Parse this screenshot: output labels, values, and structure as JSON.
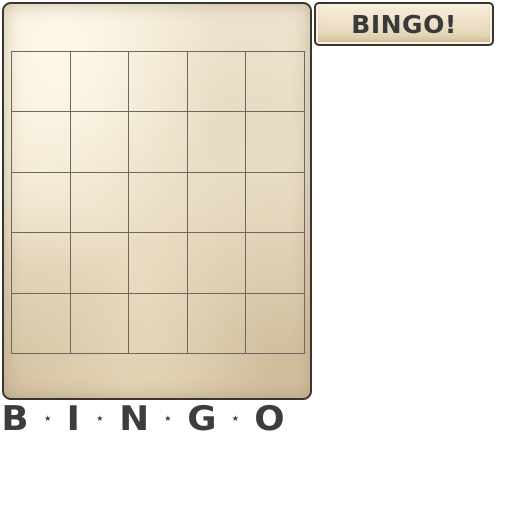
{
  "card": {
    "rows": [
      [
        "",
        "",
        "",
        "",
        ""
      ],
      [
        "",
        "",
        "",
        "",
        ""
      ],
      [
        "",
        "",
        "",
        "",
        ""
      ],
      [
        "",
        "",
        "",
        "",
        ""
      ],
      [
        "",
        "",
        "",
        "",
        ""
      ]
    ]
  },
  "bingo_button": {
    "label": "BINGO!"
  },
  "title": {
    "letters": [
      "B",
      "I",
      "N",
      "G",
      "O"
    ],
    "separator_icon": "star-icon"
  },
  "colors": {
    "paper": "#efe4cc",
    "ink": "#3a3a3c",
    "grid_line": "#6e6760"
  }
}
